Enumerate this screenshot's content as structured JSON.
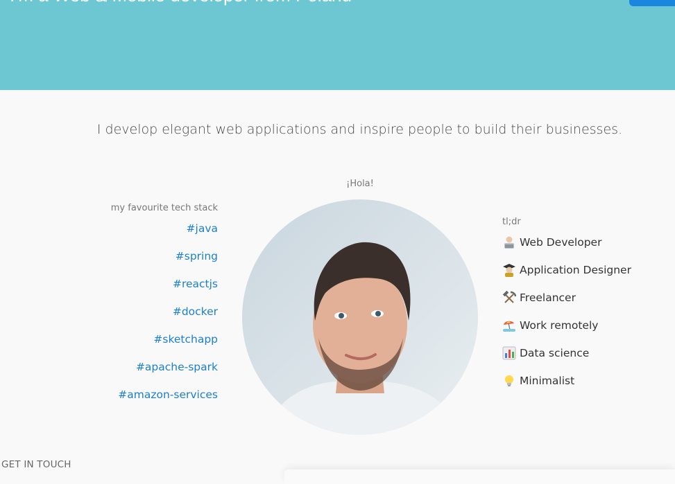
{
  "hero": {
    "title": "I'm a Web & Mobile developer from Poland",
    "accent_color": "#6cc7d3",
    "button_color": "#1a86e0"
  },
  "tagline": "I develop elegant web applications and inspire people to build their businesses.",
  "greeting": "¡Hola!",
  "tech_stack": {
    "label": "my favourite tech stack",
    "link_color": "#1a7fd3",
    "items": [
      {
        "label": "#java"
      },
      {
        "label": "#spring"
      },
      {
        "label": "#reactjs"
      },
      {
        "label": "#docker"
      },
      {
        "label": "#sketchapp"
      },
      {
        "label": "#apache-spark"
      },
      {
        "label": "#amazon-services"
      }
    ]
  },
  "tldr": {
    "label": "tl;dr",
    "items": [
      {
        "icon": "technologist-emoji",
        "label": "Web Developer"
      },
      {
        "icon": "student-emoji",
        "label": "Application Designer"
      },
      {
        "icon": "hammer-pick-emoji",
        "label": "Freelancer"
      },
      {
        "icon": "beach-umbrella-emoji",
        "label": "Work remotely"
      },
      {
        "icon": "bar-chart-emoji",
        "label": "Data science"
      },
      {
        "icon": "light-bulb-emoji",
        "label": "Minimalist"
      }
    ]
  },
  "contact": {
    "label": "GET IN TOUCH"
  }
}
